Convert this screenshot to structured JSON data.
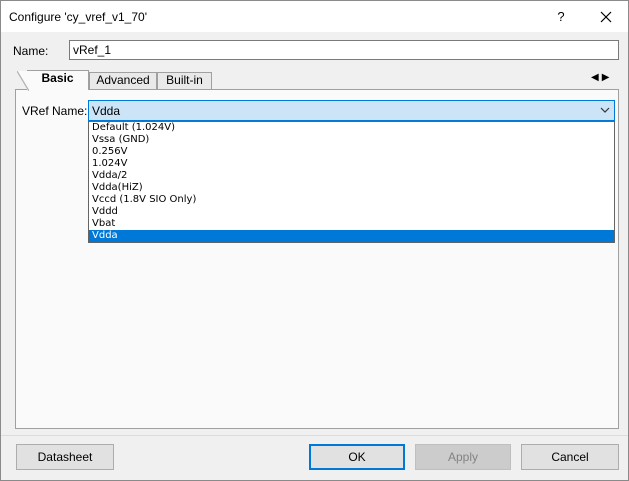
{
  "window": {
    "title": "Configure 'cy_vref_v1_70'",
    "help_glyph": "?"
  },
  "name_field": {
    "label": "Name:",
    "value": "vRef_1"
  },
  "tabs": [
    {
      "label": "Basic",
      "active": true
    },
    {
      "label": "Advanced",
      "active": false
    },
    {
      "label": "Built-in",
      "active": false
    }
  ],
  "tab_scroll": {
    "left": "◀",
    "right": "▶"
  },
  "vref": {
    "label": "VRef Name:",
    "selected": "Vdda",
    "options": [
      "Default (1.024V)",
      "Vssa (GND)",
      "0.256V",
      "1.024V",
      "Vdda/2",
      "Vdda(HiZ)",
      "Vccd (1.8V SIO Only)",
      "Vddd",
      "Vbat",
      "Vdda"
    ],
    "highlighted_index": 9
  },
  "buttons": {
    "datasheet": "Datasheet",
    "ok": "OK",
    "apply": "Apply",
    "cancel": "Cancel"
  },
  "colors": {
    "accent": "#0078d7",
    "combo_bg": "#cce4f7",
    "panel_bg": "#fafafa",
    "window_bg": "#f0f0f0"
  }
}
